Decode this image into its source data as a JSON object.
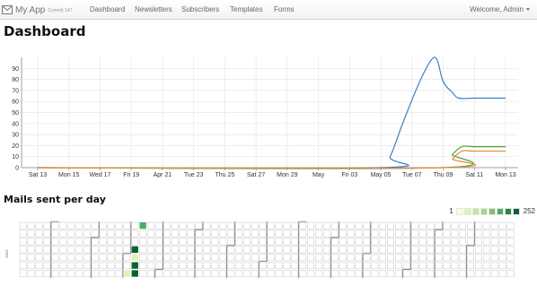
{
  "navbar": {
    "brand": "My App",
    "commit": "Commit 147",
    "links": [
      "Dashboard",
      "Newsletters",
      "Subscribers",
      "Templates",
      "Forms"
    ],
    "user_menu": "Welcome, Admin"
  },
  "page": {
    "title": "Dashboard"
  },
  "chart_data": [
    {
      "type": "line",
      "title": "",
      "xlabel": "",
      "ylabel": "",
      "categories": [
        "Sat 13",
        "Mon 15",
        "Wed 17",
        "Fri 19",
        "Apr 21",
        "Tue 23",
        "Thu 25",
        "Sat 27",
        "Mon 29",
        "May",
        "Fri 03",
        "May 05",
        "Tue 07",
        "Thu 09",
        "Sat 11",
        "Mon 13"
      ],
      "ylim": [
        0,
        100
      ],
      "yticks": [
        0,
        10,
        20,
        30,
        40,
        50,
        60,
        70,
        80,
        90
      ],
      "grid": true,
      "series": [
        {
          "color": "#3a7fc1",
          "x": [
            0,
            11,
            11.3,
            11.7,
            12.2,
            12.6,
            12.8,
            13.0,
            13.3,
            13.5,
            14,
            15
          ],
          "values": [
            0,
            0,
            10,
            40,
            75,
            97,
            98,
            78,
            68,
            63,
            63,
            63
          ]
        },
        {
          "color": "#4aa13a",
          "x": [
            0,
            12.9,
            13.3,
            13.6,
            14,
            15
          ],
          "values": [
            0,
            0,
            12,
            19,
            19,
            19
          ]
        },
        {
          "color": "#e8893a",
          "x": [
            0,
            13.0,
            13.3,
            13.6,
            14,
            15
          ],
          "values": [
            0,
            0,
            8,
            15,
            15,
            15
          ]
        }
      ]
    },
    {
      "type": "heatmap",
      "title": "Mails sent per day",
      "year": "2013",
      "legend": {
        "min": "1",
        "max": "252"
      },
      "colors": [
        "#f7fcd9",
        "#e4f2b8",
        "#c7e6a0",
        "#a4d68a",
        "#7cc27a",
        "#4daa60",
        "#238a45",
        "#0a6132"
      ],
      "cells": [
        {
          "week": 15,
          "day": 0,
          "level": 5
        },
        {
          "week": 14,
          "day": 3,
          "level": 7
        },
        {
          "week": 14,
          "day": 4,
          "level": 1
        },
        {
          "week": 14,
          "day": 5,
          "level": 7
        },
        {
          "week": 14,
          "day": 6,
          "level": 7
        },
        {
          "week": 13,
          "day": 6,
          "level": 1
        }
      ]
    }
  ]
}
